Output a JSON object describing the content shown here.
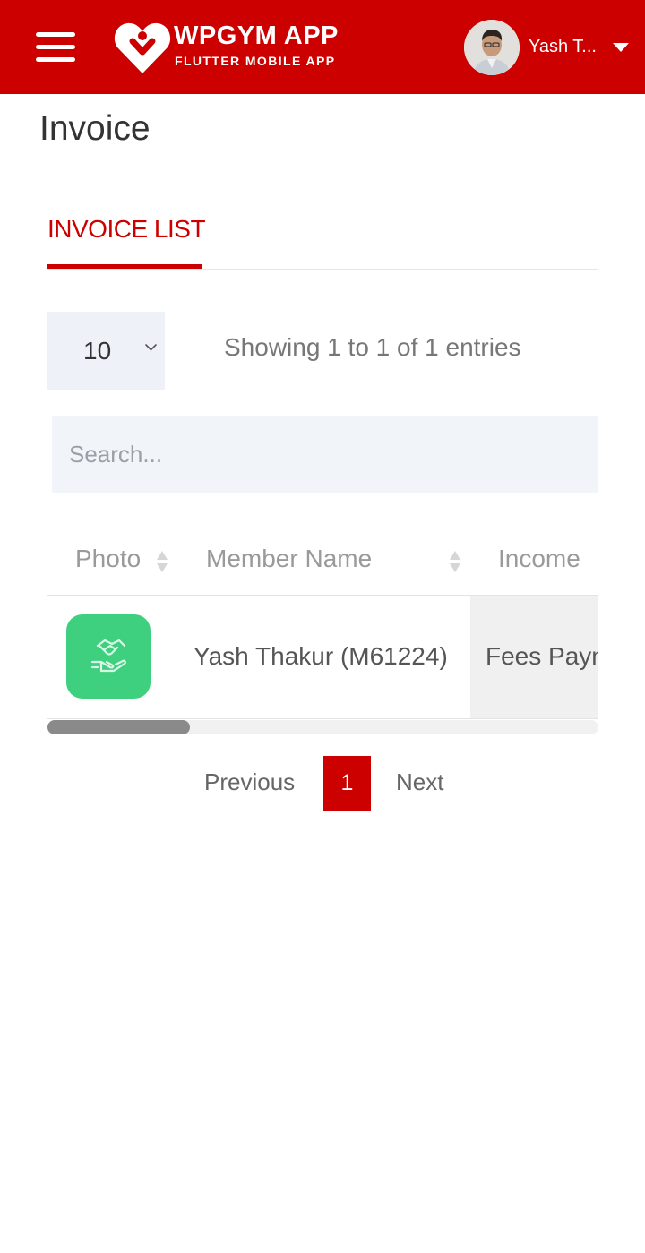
{
  "header": {
    "brand_title": "WPGYM APP",
    "brand_subtitle": "FLUTTER MOBILE APP",
    "user_name": "Yash T...",
    "accent_color": "#cd0000"
  },
  "page": {
    "title": "Invoice"
  },
  "tabs": [
    {
      "label": "INVOICE LIST",
      "active": true
    }
  ],
  "table_controls": {
    "page_length": "10",
    "entries_info": "Showing 1 to 1 of 1 entries",
    "search_placeholder": "Search..."
  },
  "table": {
    "columns": [
      "Photo",
      "Member Name",
      "Income"
    ],
    "rows": [
      {
        "photo_icon": "handshake-icon",
        "member_name": "Yash Thakur (M61224)",
        "income": "Fees Payment"
      }
    ]
  },
  "pagination": {
    "previous": "Previous",
    "current_page": "1",
    "next": "Next"
  },
  "colors": {
    "photo_bg": "#3ecf7f",
    "input_bg": "#eef2f8"
  }
}
